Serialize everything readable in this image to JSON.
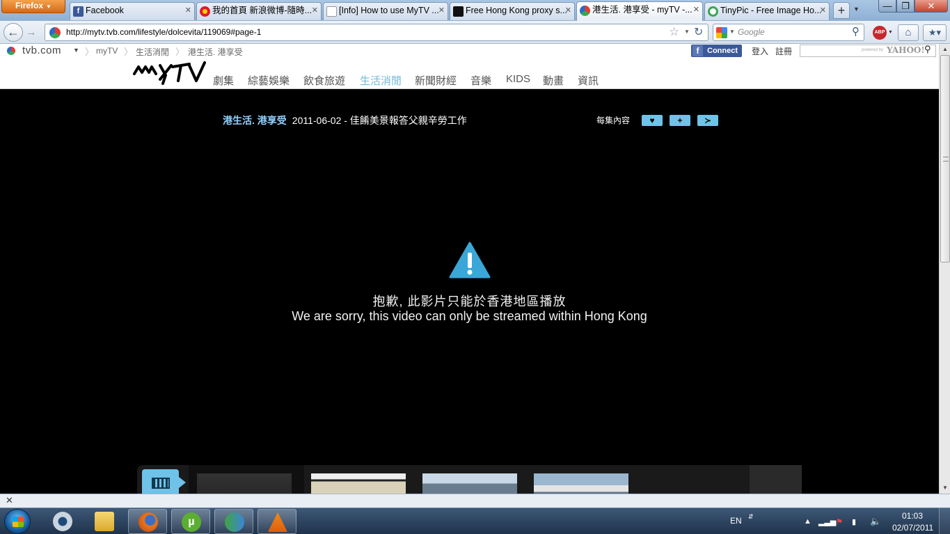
{
  "browser": {
    "app_button": "Firefox",
    "tabs": [
      {
        "label": "Facebook",
        "color": "#3b5998",
        "active": false
      },
      {
        "label": "我的首頁 新浪微博-隨時...",
        "color": "#e6162d",
        "active": false
      },
      {
        "label": "[Info] How to use MyTV ...",
        "color": "#ffffff",
        "active": false
      },
      {
        "label": "Free Hong Kong proxy s...",
        "color": "#111111",
        "active": false
      },
      {
        "label": "港生活. 港享受 - myTV -...",
        "color": "#2a6ac8",
        "active": true
      },
      {
        "label": "TinyPic - Free Image Ho...",
        "color": "#3aa655",
        "active": false
      }
    ],
    "url": "http://mytv.tvb.com/lifestyle/dolcevita/119069#page-1",
    "search_placeholder": "Google",
    "abp_label": "ABP"
  },
  "site": {
    "brand": "tvb.com",
    "breadcrumbs": [
      "myTV",
      "生活消閒",
      "港生活. 港享受"
    ],
    "fb_connect": "Connect",
    "login": "登入",
    "register": "註冊",
    "search_powered": "powered by",
    "search_brand": "YAHOO!",
    "nav": [
      {
        "label": "劇集",
        "active": false
      },
      {
        "label": "綜藝娛樂",
        "active": false
      },
      {
        "label": "飲食旅遊",
        "active": false
      },
      {
        "label": "生活消閒",
        "active": true
      },
      {
        "label": "新聞財經",
        "active": false
      },
      {
        "label": "音樂",
        "active": false
      },
      {
        "label": "KIDS",
        "active": false
      },
      {
        "label": "動畫",
        "active": false
      },
      {
        "label": "資訊",
        "active": false
      }
    ],
    "accent_color": "#75b9d9"
  },
  "video": {
    "programme": "港生活. 港享受",
    "episode": "2011-06-02 - 佳餚美景報答父親辛勞工作",
    "episode_content_label": "每集內容",
    "error_zh": "抱歉, 此影片只能於香港地區播放",
    "error_en": "We are sorry, this video can only be streamed within Hong Kong"
  },
  "taskbar": {
    "language": "EN",
    "time": "01:03",
    "date": "02/07/2011"
  }
}
